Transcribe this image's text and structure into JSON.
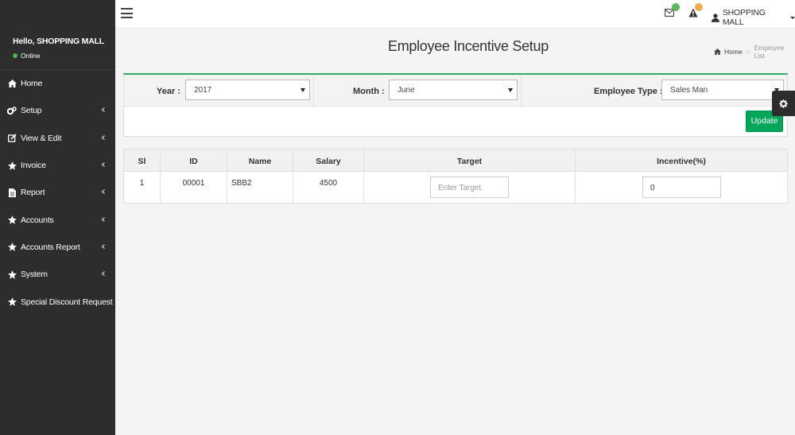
{
  "sidebar": {
    "user_greeting": "Hello, SHOPPING MALL",
    "status": "Online",
    "items": [
      {
        "label": "Home",
        "icon": "home-icon",
        "has_submenu": false
      },
      {
        "label": "Setup",
        "icon": "cogs-icon",
        "has_submenu": true
      },
      {
        "label": "View & Edit",
        "icon": "edit-icon",
        "has_submenu": true
      },
      {
        "label": "Invoice",
        "icon": "star-icon",
        "has_submenu": true
      },
      {
        "label": "Report",
        "icon": "file-icon",
        "has_submenu": true
      },
      {
        "label": "Accounts",
        "icon": "star-icon",
        "has_submenu": true
      },
      {
        "label": "Accounts Report",
        "icon": "star-icon",
        "has_submenu": true
      },
      {
        "label": "System",
        "icon": "star-icon",
        "has_submenu": true
      },
      {
        "label": "Special Discount Request",
        "icon": "star-icon",
        "has_submenu": false
      }
    ]
  },
  "topbar": {
    "user_label": "SHOPPING MALL",
    "colors": {
      "mail_badge": "#5cb85c",
      "alert_badge": "#f0ad4e"
    }
  },
  "page": {
    "title": "Employee Incentive Setup",
    "breadcrumb": {
      "home": "Home",
      "current": "Employee List"
    }
  },
  "filters": {
    "year_label": "Year :",
    "year_value": "2017",
    "month_label": "Month :",
    "month_value": "June",
    "employee_type_label": "Employee Type :",
    "employee_type_value": "Sales Man",
    "update_label": "Update",
    "accent_color": "#00a65a"
  },
  "table": {
    "columns": [
      "Sl",
      "ID",
      "Name",
      "Salary",
      "Target",
      "Incentive(%)"
    ],
    "rows": [
      {
        "sl": "1",
        "id": "00001",
        "name": "SBB2",
        "salary": "4500",
        "target_placeholder": "Enter Target",
        "incentive": "0"
      }
    ]
  }
}
